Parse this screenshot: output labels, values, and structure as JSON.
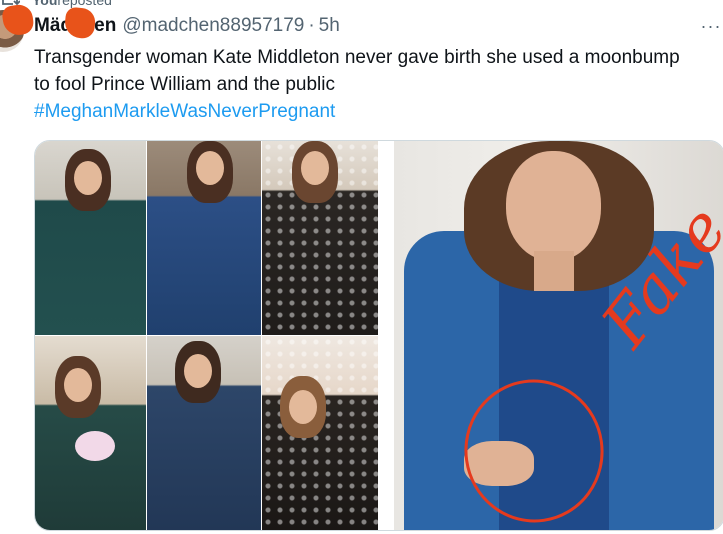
{
  "repost": {
    "user": "You",
    "suffix": " reposted",
    "icon": "repost-icon"
  },
  "post": {
    "author_name": "Mädchen",
    "handle": "@madchen88957179",
    "separator": "·",
    "time": "5h",
    "text": "Transgender woman Kate Middleton never gave birth she used a moonbump to fool Prince William and the public",
    "hashtag": "#MeghanMarkleWasNeverPregnant",
    "more_icon": "more-icon",
    "more_label": "···"
  },
  "media": {
    "annotation_text": "Fake",
    "mark_color": "#e53a1e"
  },
  "colors": {
    "link": "#1d9bf0",
    "secondary_text": "#536471",
    "redaction": "#e8531a"
  }
}
